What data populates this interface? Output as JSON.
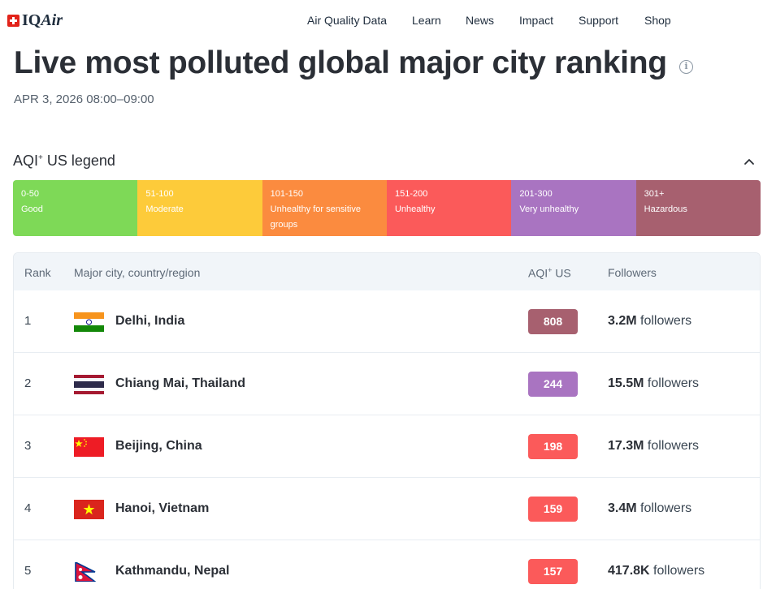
{
  "header": {
    "logo": {
      "prefix": "IQ",
      "suffix": "Air"
    },
    "nav": [
      {
        "label": "Air Quality Data"
      },
      {
        "label": "Learn"
      },
      {
        "label": "News"
      },
      {
        "label": "Impact"
      },
      {
        "label": "Support"
      },
      {
        "label": "Shop"
      }
    ]
  },
  "page": {
    "title": "Live most polluted global major city ranking",
    "timestamp": "APR 3, 2026 08:00–09:00",
    "info_icon": "info-icon"
  },
  "legend": {
    "title_main": "AQI",
    "title_sup": "+",
    "title_rest": " US legend",
    "toggle_icon": "chevron-up-icon",
    "segments": [
      {
        "range": "0-50",
        "label": "Good",
        "color": "#7ed957"
      },
      {
        "range": "51-100",
        "label": "Moderate",
        "color": "#fdcb3a"
      },
      {
        "range": "101-150",
        "label": "Unhealthy for sensitive groups",
        "color": "#fb8b3f"
      },
      {
        "range": "151-200",
        "label": "Unhealthy",
        "color": "#fb5a5a"
      },
      {
        "range": "201-300",
        "label": "Very unhealthy",
        "color": "#a974c1"
      },
      {
        "range": "301+",
        "label": "Hazardous",
        "color": "#a7606f"
      }
    ]
  },
  "table": {
    "headers": {
      "rank": "Rank",
      "city": "Major city, country/region",
      "aqi_main": "AQI",
      "aqi_sup": "+",
      "aqi_rest": " US",
      "followers": "Followers"
    },
    "rows": [
      {
        "rank": "1",
        "city": "Delhi, India",
        "flag": "india-flag",
        "aqi": "808",
        "aqi_color": "#a7606f",
        "followers_count": "3.2M",
        "followers_word": " followers"
      },
      {
        "rank": "2",
        "city": "Chiang Mai, Thailand",
        "flag": "thailand-flag",
        "aqi": "244",
        "aqi_color": "#a974c1",
        "followers_count": "15.5M",
        "followers_word": " followers"
      },
      {
        "rank": "3",
        "city": "Beijing, China",
        "flag": "china-flag",
        "aqi": "198",
        "aqi_color": "#fb5a5a",
        "followers_count": "17.3M",
        "followers_word": " followers"
      },
      {
        "rank": "4",
        "city": "Hanoi, Vietnam",
        "flag": "vietnam-flag",
        "aqi": "159",
        "aqi_color": "#fb5a5a",
        "followers_count": "3.4M",
        "followers_word": " followers"
      },
      {
        "rank": "5",
        "city": "Kathmandu, Nepal",
        "flag": "nepal-flag",
        "aqi": "157",
        "aqi_color": "#fb5a5a",
        "followers_count": "417.8K",
        "followers_word": " followers"
      }
    ]
  }
}
